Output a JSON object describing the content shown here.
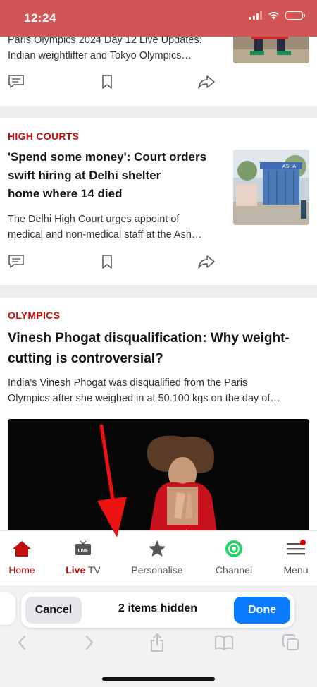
{
  "status_bar": {
    "time": "12:24"
  },
  "articles": [
    {
      "headline_lines": [
        "Paris Olympics 2024 Day 12 Live Updates:",
        "Indian weightlifter and Tokyo Olympics…"
      ]
    },
    {
      "category": "HIGH COURTS",
      "headline_lines": [
        "'Spend some money': Court orders",
        "swift hiring at Delhi shelter",
        "home where 14 died"
      ],
      "summary_lines": [
        "The Delhi High Court urges appoint of",
        "medical and non-medical staff at the Ash…"
      ],
      "thumbnail_sign_text": "ASHA"
    },
    {
      "category": "OLYMPICS",
      "headline_lines": [
        "Vinesh Phogat disqualification: Why weight-",
        "cutting is controversial?"
      ],
      "summary_lines": [
        "India's Vinesh Phogat was disqualified from the Paris",
        "Olympics after she weighed in at 50.100 kgs on the day of…"
      ]
    }
  ],
  "icons": {
    "comment": "comment-icon",
    "bookmark": "bookmark-icon",
    "share": "share-icon"
  },
  "bottom_nav": {
    "home": "Home",
    "live_prefix": "Live",
    "live_suffix": " TV",
    "live_badge": "LIVE",
    "personalise": "Personalise",
    "channel": "Channel",
    "menu": "Menu"
  },
  "safari": {
    "cancel": "Cancel",
    "hidden_count": "2 items hidden",
    "done": "Done"
  },
  "colors": {
    "status_bar": "#d15555",
    "category_red": "#c40d0d",
    "done_blue": "#0a7aff",
    "whatsapp_green": "#25d366"
  }
}
